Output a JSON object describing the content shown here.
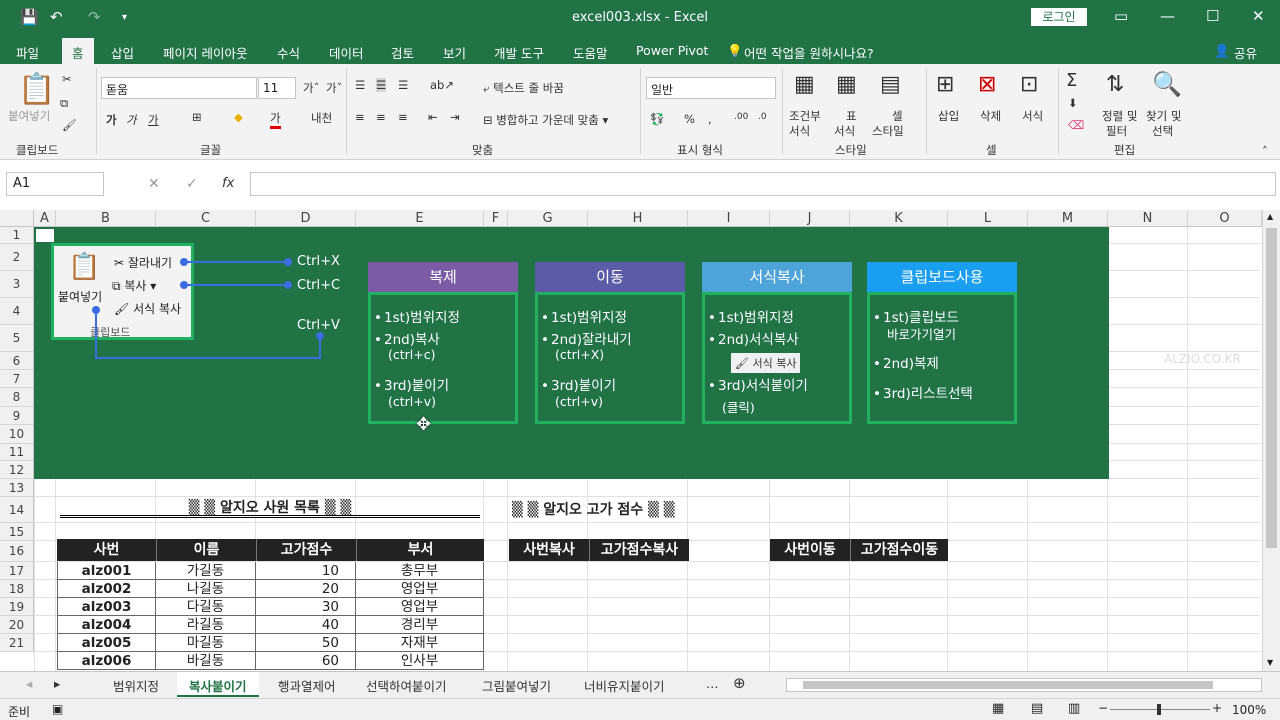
{
  "window": {
    "title": "excel003.xlsx  -  Excel",
    "login": "로그인"
  },
  "menu": {
    "items": [
      "파일",
      "홈",
      "삽입",
      "페이지 레이아웃",
      "수식",
      "데이터",
      "검토",
      "보기",
      "개발 도구",
      "도움말",
      "Power Pivot"
    ],
    "tell": "어떤 작업을 원하시나요?",
    "share": "공유",
    "active": "홈"
  },
  "ribbon": {
    "paste": "붙여넣기",
    "clipboard": "클립보드",
    "font_name": "돋움",
    "font_size": "11",
    "font_group": "글꼴",
    "wrap": "텍스트 줄 바꿈",
    "merge": "병합하고 가운데 맞춤",
    "align_group": "맞춤",
    "number_format": "일반",
    "number_group": "표시 형식",
    "cond_format": "조건부",
    "cond_format2": "서식",
    "table_fmt": "표",
    "table_fmt2": "서식",
    "cell_style": "셀",
    "cell_style2": "스타일",
    "style_group": "스타일",
    "insert": "삽입",
    "delete": "삭제",
    "format": "서식",
    "cell_group": "셀",
    "sort": "정렬 및",
    "sort2": "필터",
    "find": "찾기 및",
    "find2": "선택",
    "edit_group": "편집"
  },
  "formula": {
    "namebox": "A1",
    "value": ""
  },
  "columns": [
    "A",
    "B",
    "C",
    "D",
    "E",
    "F",
    "G",
    "H",
    "I",
    "J",
    "K",
    "L",
    "M",
    "N",
    "O"
  ],
  "rows": [
    "1",
    "2",
    "3",
    "4",
    "5",
    "6",
    "7",
    "8",
    "9",
    "10",
    "11",
    "12",
    "13",
    "14",
    "15",
    "16",
    "17",
    "18",
    "19",
    "20",
    "21"
  ],
  "diagram": {
    "clip_paste": "붙여넣기",
    "clip_cut": "잘라내기",
    "clip_copy": "복사",
    "clip_fmt": "서식 복사",
    "clip_group": "클립보드",
    "ctrl_x": "Ctrl+X",
    "ctrl_c": "Ctrl+C",
    "ctrl_v": "Ctrl+V",
    "watermark": "ALZIO.CO.KR",
    "fmt_brush": "서식 복사",
    "cards": [
      {
        "title": "복제",
        "color": "#7b5aa6",
        "lines": [
          "1st)범위지정",
          "2nd)복사",
          "(ctrl+c)",
          "3rd)붙이기",
          "(ctrl+v)"
        ]
      },
      {
        "title": "이동",
        "color": "#5b5ba8",
        "lines": [
          "1st)범위지정",
          "2nd)잘라내기",
          "(ctrl+X)",
          "3rd)붙이기",
          "(ctrl+v)"
        ]
      },
      {
        "title": "서식복사",
        "color": "#4ea3d8",
        "lines": [
          "1st)범위지정",
          "2nd)서식복사",
          "3rd)서식붙이기",
          "(클릭)"
        ]
      },
      {
        "title": "클립보드사용",
        "color": "#1a9ef0",
        "lines": [
          "1st)클립보드",
          "바로가기열기",
          "2nd)복제",
          "3rd)리스트선택"
        ]
      }
    ]
  },
  "table1": {
    "title": "▒ ▒ 알지오 사원 목록 ▒ ▒",
    "headers": [
      "사번",
      "이름",
      "고가점수",
      "부서"
    ],
    "rows": [
      [
        "alz001",
        "가길동",
        "10",
        "총무부"
      ],
      [
        "alz002",
        "나길동",
        "20",
        "영업부"
      ],
      [
        "alz003",
        "다길동",
        "30",
        "영업부"
      ],
      [
        "alz004",
        "라길동",
        "40",
        "경리부"
      ],
      [
        "alz005",
        "마길동",
        "50",
        "자재부"
      ],
      [
        "alz006",
        "바길동",
        "60",
        "인사부"
      ]
    ]
  },
  "table2": {
    "title": "▒ ▒ 알지오 고가 점수 ▒ ▒",
    "h1": "사번복사",
    "h2": "고가점수복사",
    "h3": "사번이동",
    "h4": "고가점수이동"
  },
  "sheets": [
    "범위지정",
    "복사붙이기",
    "행과열제어",
    "선택하여붙이기",
    "그림붙여넣기",
    "너비유지붙이기"
  ],
  "active_sheet": "복사붙이기",
  "status": {
    "ready": "준비",
    "zoom": "100%"
  }
}
